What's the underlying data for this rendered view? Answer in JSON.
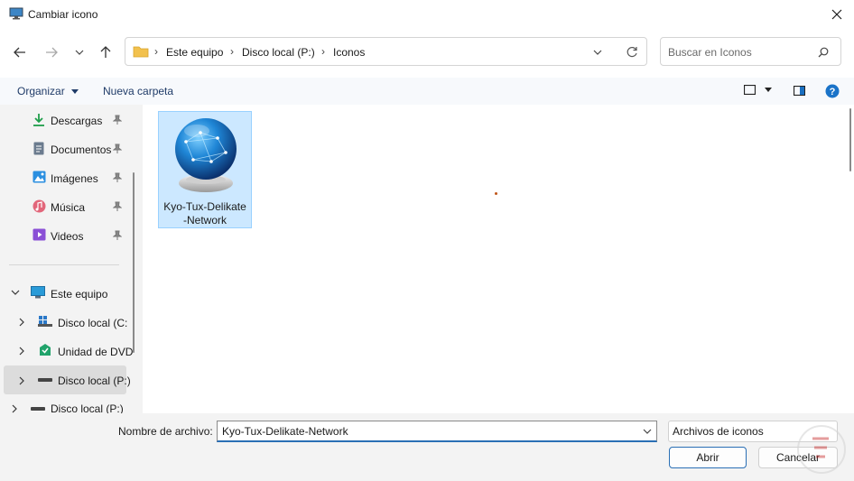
{
  "window": {
    "title": "Cambiar icono"
  },
  "nav": {
    "breadcrumb": [
      "Este equipo",
      "Disco local (P:)",
      "Iconos"
    ],
    "search_placeholder": "Buscar en Iconos"
  },
  "command_bar": {
    "organize": "Organizar",
    "new_folder": "Nueva carpeta"
  },
  "sidebar": {
    "quick_access": [
      {
        "label": "Descargas",
        "icon": "download-icon"
      },
      {
        "label": "Documentos",
        "icon": "document-icon"
      },
      {
        "label": "Imágenes",
        "icon": "pictures-icon"
      },
      {
        "label": "Música",
        "icon": "music-icon"
      },
      {
        "label": "Videos",
        "icon": "video-icon"
      }
    ],
    "this_pc": "Este equipo",
    "drives": [
      {
        "label": "Disco local (C:",
        "icon": "windows-drive-icon"
      },
      {
        "label": "Unidad de DVD",
        "icon": "dvd-drive-icon"
      },
      {
        "label": "Disco local (P:)",
        "icon": "drive-icon",
        "selected": true
      },
      {
        "label": "Disco local (P:)",
        "icon": "drive-icon"
      }
    ]
  },
  "files": [
    {
      "name": "Kyo-Tux-Delikate-Network",
      "label_line1": "Kyo-Tux-Delikate",
      "label_line2": "-Network",
      "icon": "network-globe-icon",
      "selected": true
    }
  ],
  "footer": {
    "filename_label": "Nombre de archivo:",
    "filename_value": "Kyo-Tux-Delikate-Network",
    "filetype_value": "Archivos de iconos",
    "open_label": "Abrir",
    "cancel_label": "Cancelar"
  },
  "colors": {
    "accent": "#2a6fb5",
    "selection": "#cce8ff",
    "folder": "#f2c14e"
  }
}
